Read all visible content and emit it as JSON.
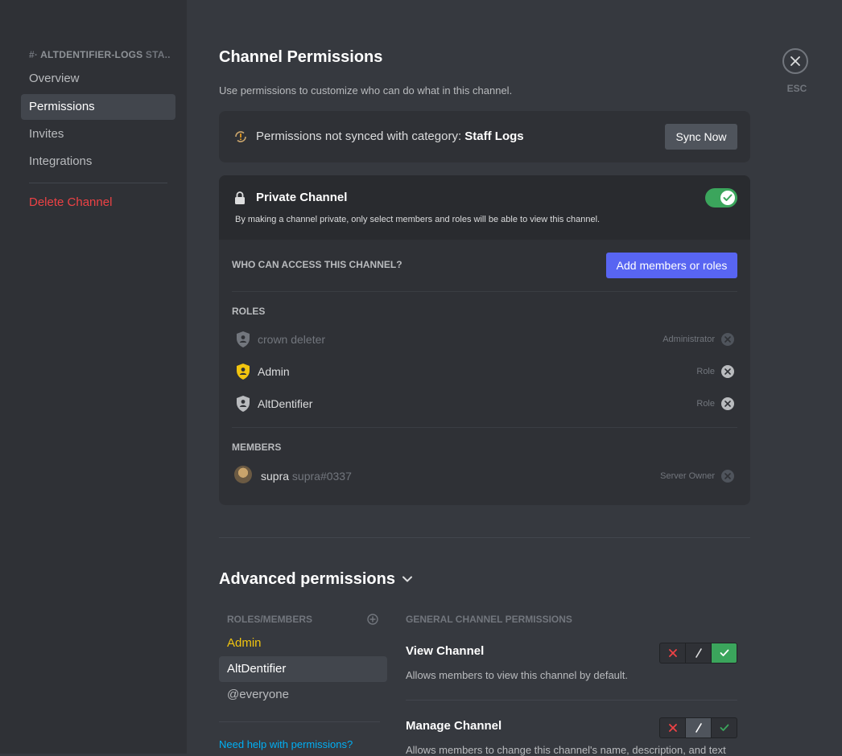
{
  "sidebar": {
    "channel_prefix": "#·",
    "channel_name": "ALTDENTIFIER-LOGS",
    "channel_category_short": "STA...",
    "items": [
      {
        "label": "Overview"
      },
      {
        "label": "Permissions"
      },
      {
        "label": "Invites"
      },
      {
        "label": "Integrations"
      }
    ],
    "delete_label": "Delete Channel",
    "selected_index": 1
  },
  "close": {
    "esc_label": "ESC"
  },
  "header": {
    "title": "Channel Permissions",
    "subtitle": "Use permissions to customize who can do what in this channel."
  },
  "sync": {
    "text": "Permissions not synced with category: ",
    "category": "Staff Logs",
    "button": "Sync Now"
  },
  "private": {
    "title": "Private Channel",
    "description": "By making a channel private, only select members and roles will be able to view this channel.",
    "enabled": true,
    "who_label": "WHO CAN ACCESS THIS CHANNEL?",
    "add_button": "Add members or roles",
    "roles_label": "ROLES",
    "roles": [
      {
        "name": "crown deleter",
        "type": "Administrator",
        "icon": "shield-person-icon",
        "color": "#b9bbbe"
      },
      {
        "name": "Admin",
        "type": "Role",
        "icon": "shield-person-icon",
        "color": "#f1c40f"
      },
      {
        "name": "AltDentifier",
        "type": "Role",
        "icon": "shield-person-icon",
        "color": "#b9bbbe"
      }
    ],
    "members_label": "MEMBERS",
    "members": [
      {
        "name": "supra",
        "tag": "supra#0337",
        "type": "Server Owner"
      }
    ]
  },
  "advanced": {
    "title": "Advanced permissions",
    "roles_members_label": "ROLES/MEMBERS",
    "list": [
      {
        "label": "Admin"
      },
      {
        "label": "AltDentifier"
      },
      {
        "label": "@everyone"
      }
    ],
    "help_link": "Need help with permissions?",
    "general_label": "GENERAL CHANNEL PERMISSIONS",
    "permissions": [
      {
        "name": "View Channel",
        "description": "Allows members to view this channel by default.",
        "state": "allow"
      },
      {
        "name": "Manage Channel",
        "description": "Allows members to change this channel's name, description, and text",
        "state": "neutral"
      }
    ]
  },
  "colors": {
    "accent": "#5865f2",
    "success": "#3ba55c",
    "danger": "#ed4245",
    "admin_role": "#f1c40f",
    "link": "#00aff4"
  }
}
